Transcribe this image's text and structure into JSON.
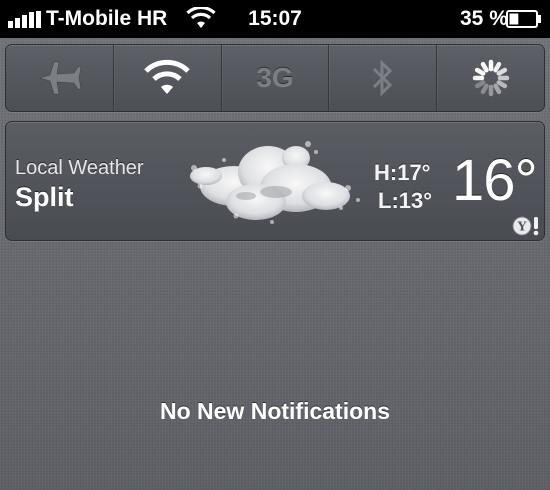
{
  "status_bar": {
    "carrier": "T-Mobile HR",
    "time": "15:07",
    "battery_percent": "35 %",
    "signal_icon": "signal-bars-icon",
    "wifi_icon": "wifi-icon",
    "battery_icon": "battery-icon",
    "battery_level": 0.35
  },
  "toggles": [
    {
      "name": "airplane-mode",
      "icon": "airplane-icon",
      "state": "off"
    },
    {
      "name": "wifi",
      "icon": "wifi-icon",
      "state": "on"
    },
    {
      "name": "cellular-3g",
      "label": "3G",
      "state": "off"
    },
    {
      "name": "bluetooth",
      "icon": "bluetooth-icon",
      "state": "off"
    },
    {
      "name": "loading",
      "icon": "spinner-icon",
      "state": "busy"
    }
  ],
  "weather": {
    "subtitle": "Local Weather",
    "city": "Split",
    "high": "H:17°",
    "low": "L:13°",
    "temperature": "16°",
    "condition_icon": "cloud-icon",
    "provider_icon": "yahoo-logo-icon"
  },
  "notifications": {
    "empty_message": "No New Notifications"
  },
  "colors": {
    "background": "#6a6c73",
    "active_toggle": "#ffffff",
    "inactive_toggle": "#7c7e85"
  }
}
